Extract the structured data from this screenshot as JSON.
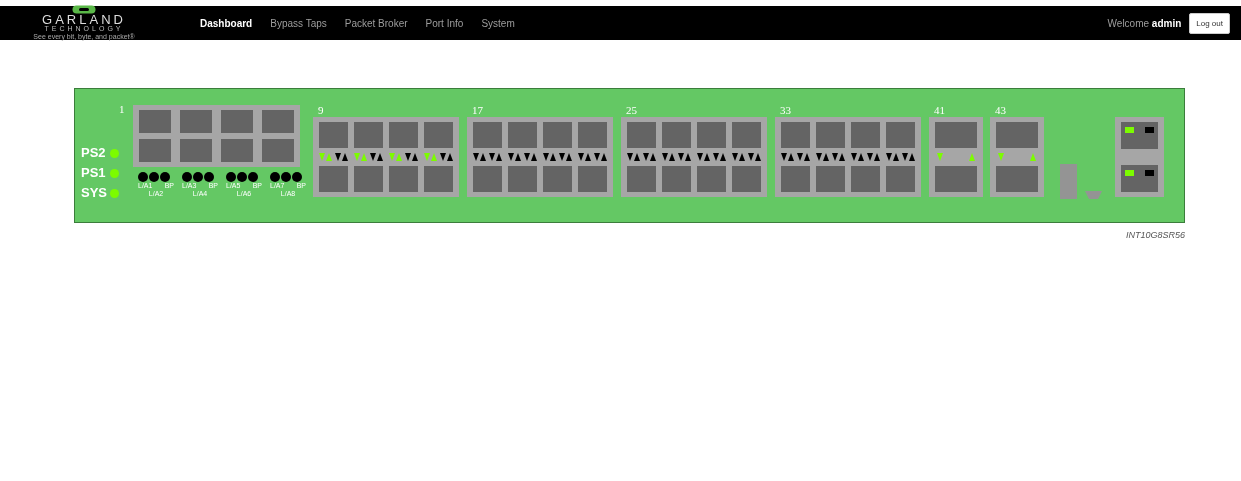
{
  "navbar": {
    "logo": {
      "name": "GARLAND",
      "subtitle": "TECHNOLOGY",
      "tagline": "See every bit, byte, and packet®"
    },
    "items": [
      {
        "label": "Dashboard",
        "selected": true
      },
      {
        "label": "Bypass Taps",
        "selected": false
      },
      {
        "label": "Packet Broker",
        "selected": false
      },
      {
        "label": "Port Info",
        "selected": false
      },
      {
        "label": "System",
        "selected": false
      }
    ],
    "welcome": "Welcome **admin**",
    "logout": "Log out"
  },
  "device": {
    "status_leds": [
      {
        "label": "PS2",
        "on": true
      },
      {
        "label": "PS1",
        "on": true
      },
      {
        "label": "SYS",
        "on": true
      }
    ],
    "copper": {
      "label": "1"
    },
    "bypass_groups": [
      {
        "leds": [
          {
            "on": false
          },
          {
            "on": false
          },
          {
            "on": false
          }
        ],
        "labels": [
          "L/A1",
          "BP"
        ],
        "sublabel": "L/A2"
      },
      {
        "leds": [
          {
            "on": false
          },
          {
            "on": false
          },
          {
            "on": false
          }
        ],
        "labels": [
          "L/A3",
          "BP"
        ],
        "sublabel": "L/A4"
      },
      {
        "leds": [
          {
            "on": false
          },
          {
            "on": false
          },
          {
            "on": false
          }
        ],
        "labels": [
          "L/A5",
          "BP"
        ],
        "sublabel": "L/A6"
      },
      {
        "leds": [
          {
            "on": false
          },
          {
            "on": false
          },
          {
            "on": false
          }
        ],
        "labels": [
          "L/A7",
          "BP"
        ],
        "sublabel": "L/A8"
      }
    ],
    "port_groups": [
      {
        "label": "9",
        "kind": "quad",
        "ports": [
          {
            "link": true
          },
          {
            "link": false
          },
          {
            "link": true
          },
          {
            "link": false
          },
          {
            "link": true
          },
          {
            "link": false
          },
          {
            "link": true
          },
          {
            "link": false
          }
        ]
      },
      {
        "label": "17",
        "kind": "quad",
        "ports": [
          {
            "link": false
          },
          {
            "link": false
          },
          {
            "link": false
          },
          {
            "link": false
          },
          {
            "link": false
          },
          {
            "link": false
          },
          {
            "link": false
          },
          {
            "link": false
          }
        ]
      },
      {
        "label": "25",
        "kind": "quad",
        "ports": [
          {
            "link": false
          },
          {
            "link": false
          },
          {
            "link": false
          },
          {
            "link": false
          },
          {
            "link": false
          },
          {
            "link": false
          },
          {
            "link": false
          },
          {
            "link": false
          }
        ]
      },
      {
        "label": "33",
        "kind": "quad",
        "ports": [
          {
            "link": false
          },
          {
            "link": false
          },
          {
            "link": false
          },
          {
            "link": false
          },
          {
            "link": false
          },
          {
            "link": false
          },
          {
            "link": false
          },
          {
            "link": false
          }
        ]
      },
      {
        "label": "41",
        "kind": "single",
        "ports": [
          {
            "link": true
          }
        ]
      },
      {
        "label": "43",
        "kind": "single",
        "ports": [
          {
            "link": true
          }
        ]
      }
    ],
    "management_ports": [
      {
        "leds": [
          {
            "on": true
          },
          {
            "on": false
          }
        ]
      },
      {
        "leds": [
          {
            "on": true
          },
          {
            "on": false
          }
        ]
      }
    ],
    "model": "INT10G8SR56"
  }
}
